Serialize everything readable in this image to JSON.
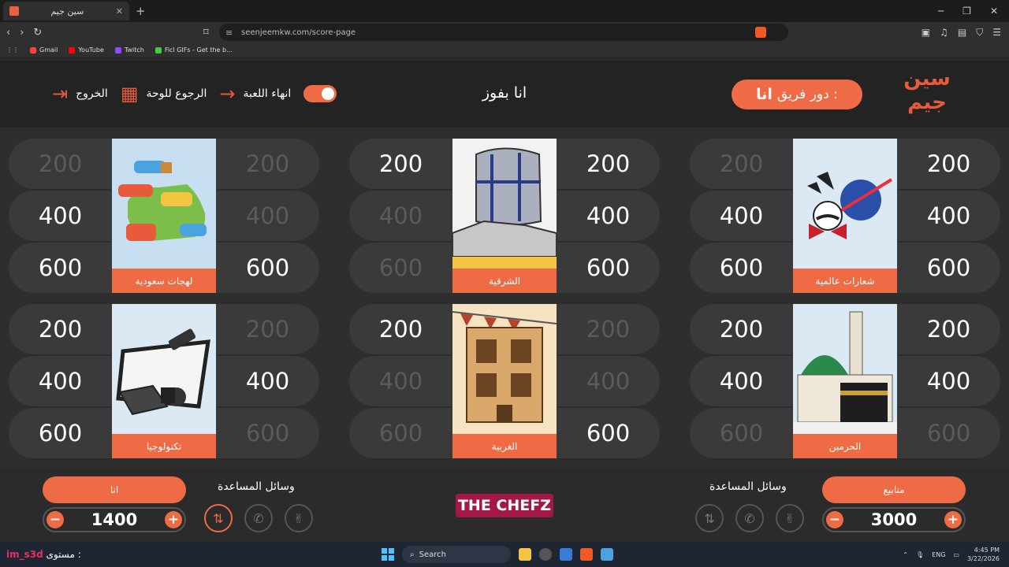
{
  "browser": {
    "tab_title": "سين جيم",
    "url": "seenjeemkw.com/score-page",
    "bookmarks": [
      "Gmail",
      "YouTube",
      "Twitch",
      "Ficl GIFs - Get the b..."
    ]
  },
  "header": {
    "logo": "سين جيم",
    "turn_label": "دور فريق :",
    "turn_team": "انا",
    "game_name": "انا بفوز",
    "end_label": "انهاء اللعبة",
    "board_label": "الرجوع للوحة",
    "exit_label": "الخروج"
  },
  "categories": [
    {
      "name": "لهجات سعودية",
      "art": "saudi-dialects",
      "left": [
        "200",
        "400",
        "600"
      ],
      "right": [
        "200",
        "400",
        "600"
      ],
      "left_used": [
        true,
        false,
        false
      ],
      "right_used": [
        true,
        true,
        false
      ]
    },
    {
      "name": "الشرقية",
      "art": "eastern",
      "left": [
        "200",
        "400",
        "600"
      ],
      "right": [
        "200",
        "400",
        "600"
      ],
      "left_used": [
        false,
        true,
        true
      ],
      "right_used": [
        false,
        false,
        false
      ]
    },
    {
      "name": "شعارات عالمية",
      "art": "logos",
      "left": [
        "200",
        "400",
        "600"
      ],
      "right": [
        "200",
        "400",
        "600"
      ],
      "left_used": [
        true,
        false,
        false
      ],
      "right_used": [
        false,
        false,
        false
      ]
    },
    {
      "name": "تكنولوجيا",
      "art": "tech",
      "left": [
        "200",
        "400",
        "600"
      ],
      "right": [
        "200",
        "400",
        "600"
      ],
      "left_used": [
        false,
        false,
        false
      ],
      "right_used": [
        true,
        false,
        true
      ]
    },
    {
      "name": "الغربية",
      "art": "western",
      "left": [
        "200",
        "400",
        "600"
      ],
      "right": [
        "200",
        "400",
        "600"
      ],
      "left_used": [
        false,
        true,
        true
      ],
      "right_used": [
        true,
        true,
        false
      ]
    },
    {
      "name": "الحرمين",
      "art": "haramain",
      "left": [
        "200",
        "400",
        "600"
      ],
      "right": [
        "200",
        "400",
        "600"
      ],
      "left_used": [
        false,
        false,
        true
      ],
      "right_used": [
        false,
        false,
        true
      ]
    }
  ],
  "footer": {
    "team1": {
      "name": "انا",
      "score": "1400",
      "aids_label": "وسائل المساعدة"
    },
    "team2": {
      "name": "متابيع",
      "score": "3000",
      "aids_label": "وسائل المساعدة"
    },
    "sponsor": "THE CHEFZ"
  },
  "taskbar": {
    "user_label": "مستوى :",
    "user": "im_s3d",
    "search": "Search",
    "lang": "ENG",
    "time": "4:45 PM",
    "date": "3/22/2026"
  },
  "colors": {
    "accent": "#ef6b45",
    "bg": "#2e2e2e"
  }
}
